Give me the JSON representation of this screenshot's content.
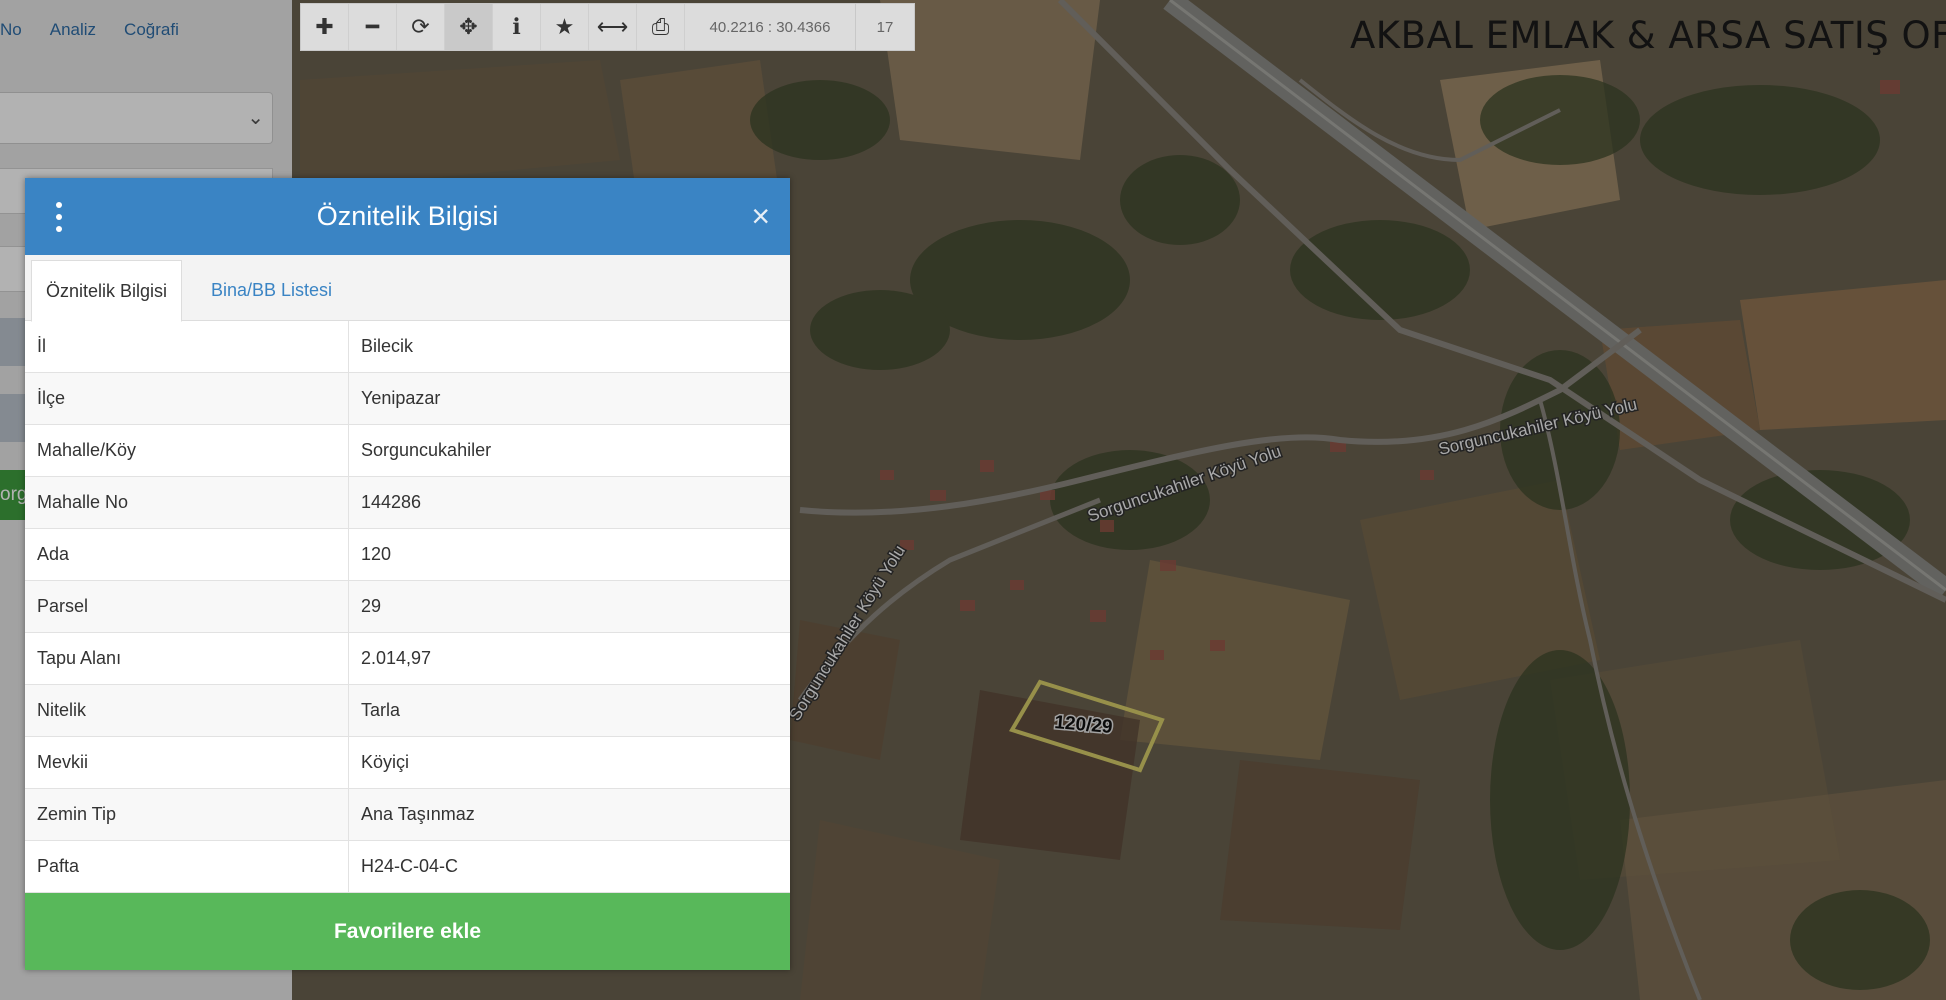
{
  "watermark": "AKBAL EMLAK & ARSA SATIŞ OFİSİ",
  "toolbar": {
    "buttons": [
      {
        "icon": "plus-icon",
        "glyph": "✚"
      },
      {
        "icon": "minus-icon",
        "glyph": "━"
      },
      {
        "icon": "refresh-icon",
        "glyph": "⟳"
      },
      {
        "icon": "move-icon",
        "glyph": "✥"
      },
      {
        "icon": "info-icon",
        "glyph": "ℹ"
      },
      {
        "icon": "star-icon",
        "glyph": "★"
      },
      {
        "icon": "measure-icon",
        "glyph": "⟷"
      },
      {
        "icon": "print-icon",
        "glyph": "⎙"
      }
    ],
    "coordinates": "40.2216 : 30.4366",
    "zoom": "17"
  },
  "sidebar": {
    "menu": [
      "No",
      "Analiz",
      "Coğrafi"
    ],
    "green_button_fragment": "org"
  },
  "map": {
    "roads": [
      "Sorguncukahiler Köyü Yolu",
      "Sorguncukahiler Köyü Yolu",
      "Sorguncukahiler Köyü Yolu"
    ],
    "parcel_label": "120/29"
  },
  "modal": {
    "title": "Öznitelik Bilgisi",
    "close": "×",
    "tabs": [
      "Öznitelik Bilgisi",
      "Bina/BB Listesi"
    ],
    "rows": [
      {
        "key": "İl",
        "value": "Bilecik"
      },
      {
        "key": "İlçe",
        "value": "Yenipazar"
      },
      {
        "key": "Mahalle/Köy",
        "value": "Sorguncukahiler"
      },
      {
        "key": "Mahalle No",
        "value": "144286"
      },
      {
        "key": "Ada",
        "value": "120"
      },
      {
        "key": "Parsel",
        "value": "29"
      },
      {
        "key": "Tapu Alanı",
        "value": "2.014,97"
      },
      {
        "key": "Nitelik",
        "value": "Tarla"
      },
      {
        "key": "Mevkii",
        "value": "Köyiçi"
      },
      {
        "key": "Zemin Tip",
        "value": "Ana Taşınmaz"
      },
      {
        "key": "Pafta",
        "value": "H24-C-04-C"
      }
    ],
    "favorite_button": "Favorilere ekle"
  },
  "colors": {
    "modal_header": "#3a84c4",
    "favorite_button": "#58b85a",
    "tab_link": "#3a84c4"
  }
}
